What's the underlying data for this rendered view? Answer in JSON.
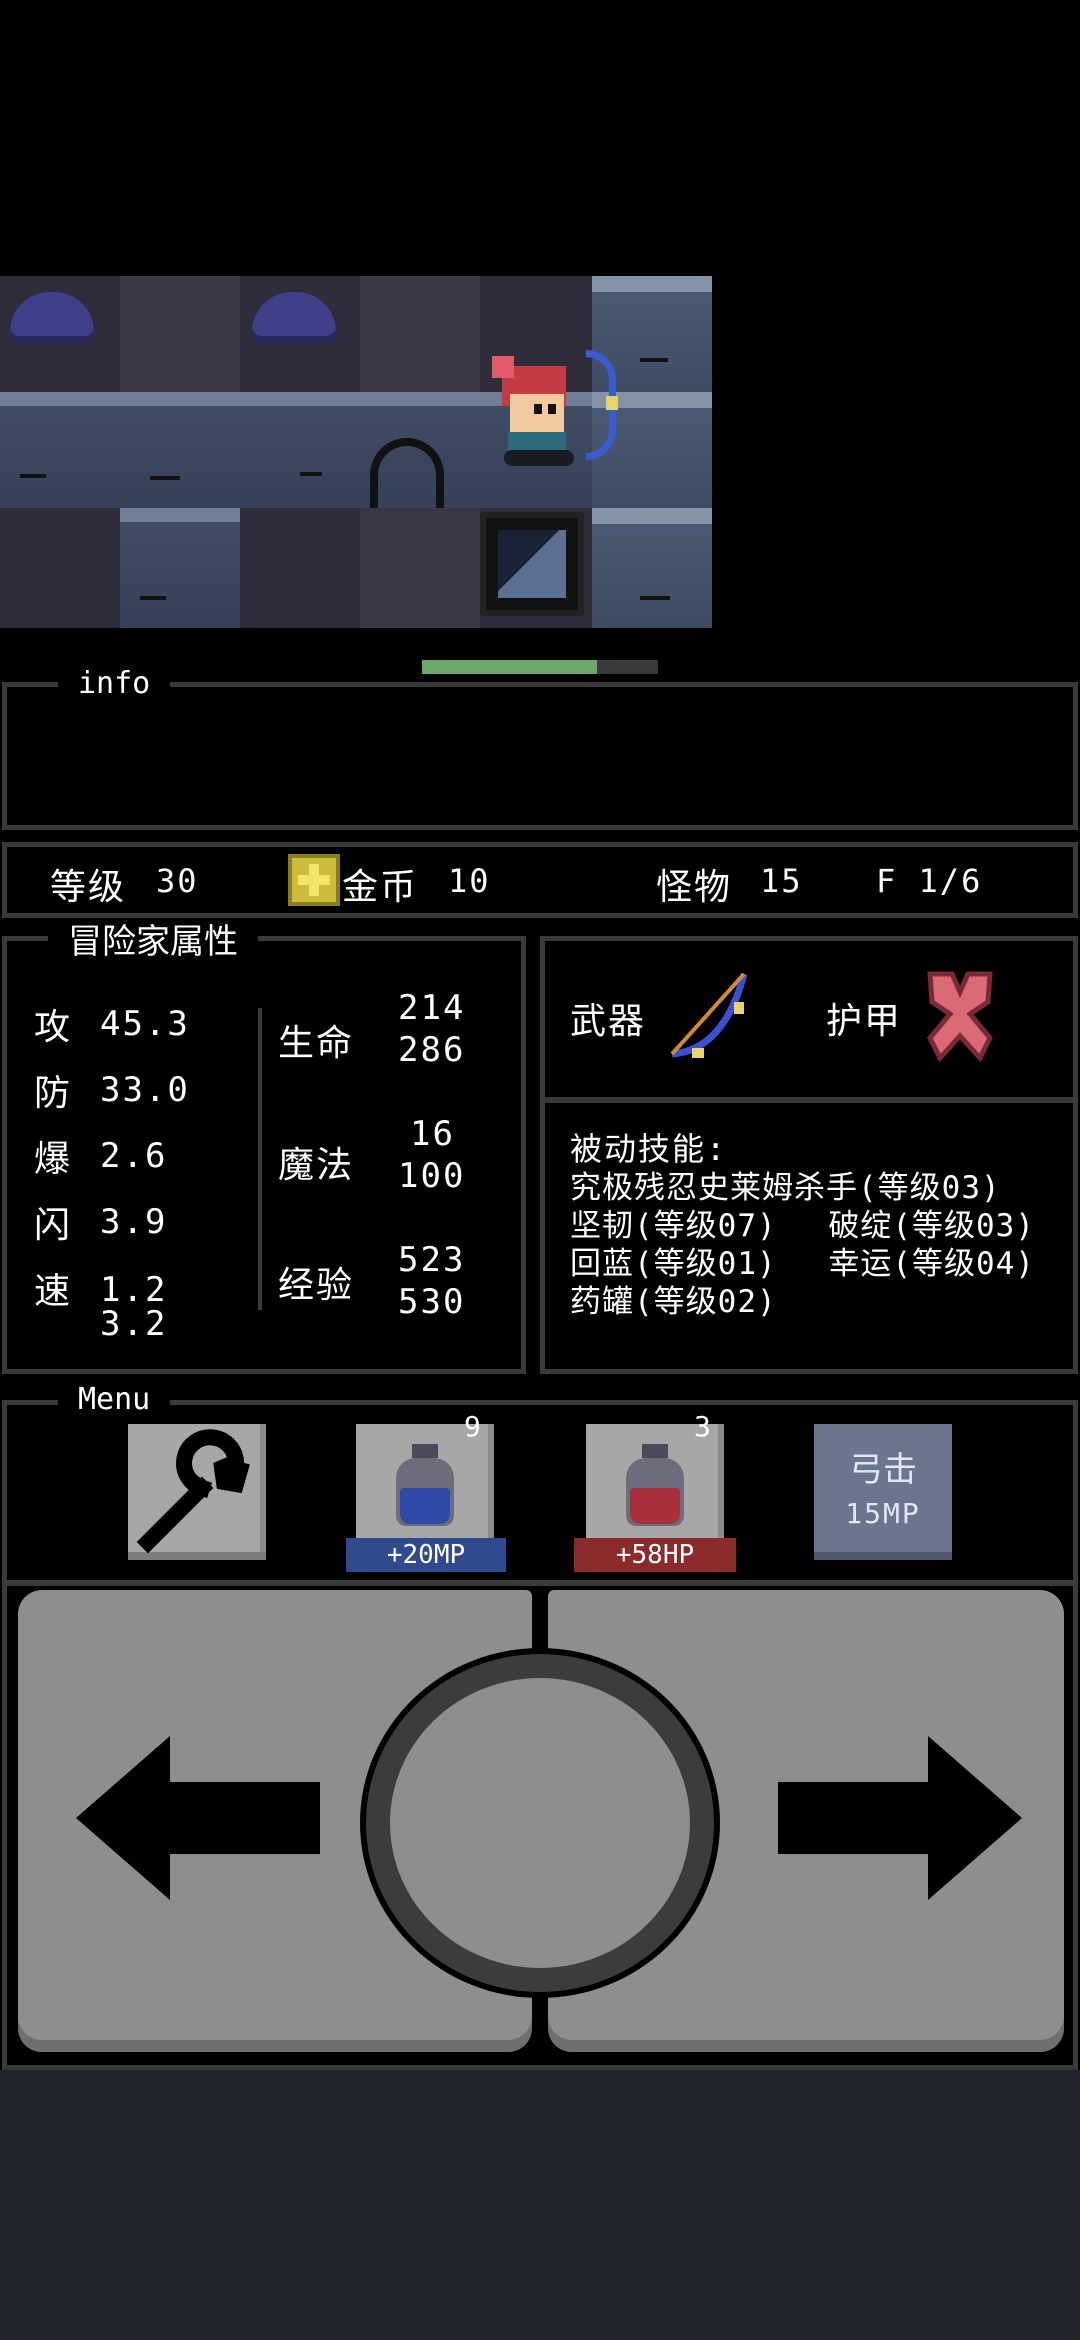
{
  "info_panel": {
    "legend": "info"
  },
  "hero_hp_fraction": 0.74,
  "status_bar": {
    "level_label": "等级",
    "level_value": "30",
    "gold_label": "金币",
    "gold_value": "10",
    "monster_label": "怪物",
    "monster_value": "15",
    "floor_text": "F 1/6"
  },
  "attributes": {
    "legend": "冒险家属性",
    "stats": [
      {
        "label": "攻",
        "value": "45.3"
      },
      {
        "label": "防",
        "value": "33.0"
      },
      {
        "label": "爆",
        "value": "2.6"
      },
      {
        "label": "闪",
        "value": "3.9"
      },
      {
        "label": "速",
        "value": "1.2",
        "value2": "3.2"
      }
    ],
    "hp": {
      "label": "生命",
      "current": "214",
      "max": "286"
    },
    "mp": {
      "label": "魔法",
      "current": "16",
      "max": "100"
    },
    "exp": {
      "label": "经验",
      "current": "523",
      "max": "530"
    }
  },
  "equipment": {
    "weapon_label": "武器",
    "armor_label": "护甲",
    "weapon_icon": "bow-icon",
    "armor_icon": "armor-icon"
  },
  "skills": {
    "title": "被动技能:",
    "lines": [
      "究极残忍史莱姆杀手(等级03)",
      "坚韧(等级07)　 破绽(等级03)",
      "回蓝(等级01)　 幸运(等级04)",
      "药罐(等级02)"
    ]
  },
  "menu": {
    "legend": "Menu",
    "blue_potion_count": "9",
    "blue_potion_label": "+20MP",
    "red_potion_count": "3",
    "red_potion_label": "+58HP",
    "skill_line1": "弓击",
    "skill_line2": "15MP"
  },
  "colors": {
    "bg": "#000000",
    "panel_border": "#3a3a3a",
    "hp_bar": "#6fa86b",
    "mp_tag": "#2f4a8f",
    "hp_tag": "#8a2a2a"
  }
}
